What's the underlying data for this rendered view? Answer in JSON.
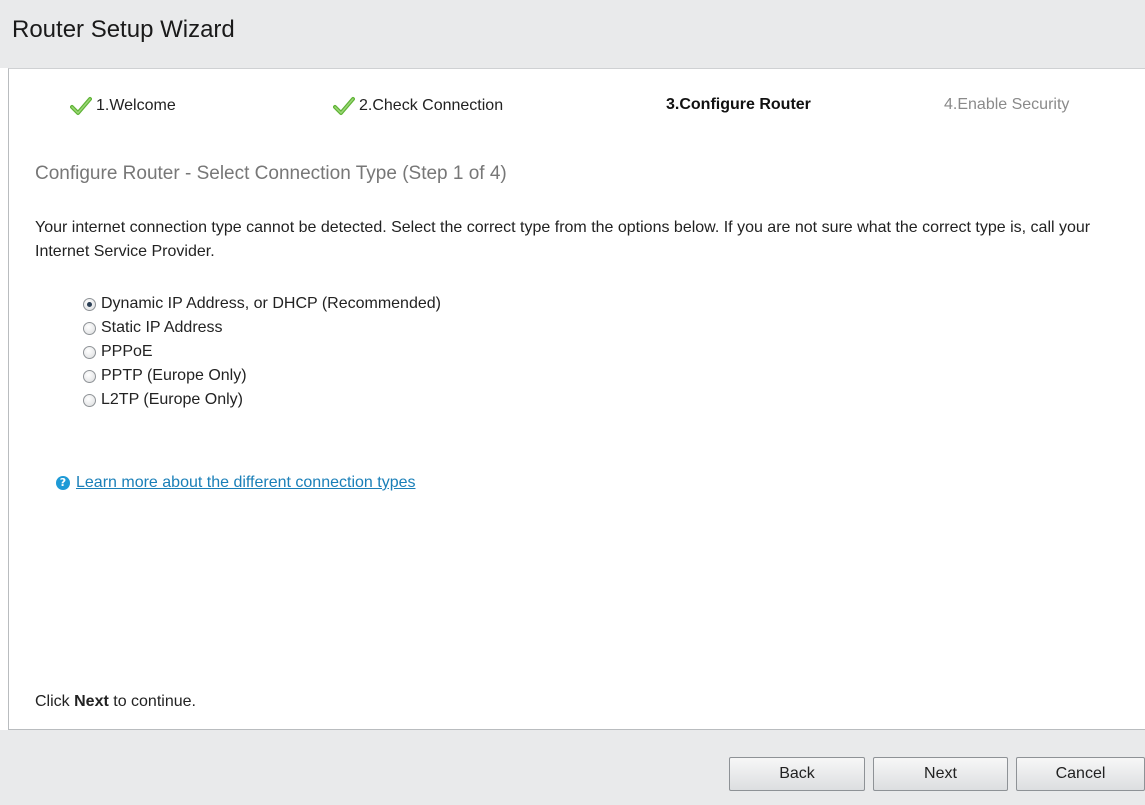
{
  "window": {
    "title": "Router Setup Wizard"
  },
  "steps": [
    {
      "label": "1.Welcome",
      "status": "completed",
      "icon": "checkmark-icon"
    },
    {
      "label": "2.Check Connection",
      "status": "completed",
      "icon": "checkmark-icon"
    },
    {
      "label": "3.Configure Router",
      "status": "current"
    },
    {
      "label": "4.Enable Security",
      "status": "upcoming"
    }
  ],
  "content": {
    "heading": "Configure Router - Select Connection Type (Step 1 of 4)",
    "intro": "Your internet connection type cannot be detected. Select the correct type from the options below. If you are not sure what the correct type is, call your Internet Service Provider.",
    "connection_types": [
      {
        "label": "Dynamic IP Address, or DHCP (Recommended)",
        "selected": true
      },
      {
        "label": "Static IP Address",
        "selected": false
      },
      {
        "label": "PPPoE",
        "selected": false
      },
      {
        "label": "PPTP (Europe Only)",
        "selected": false
      },
      {
        "label": "L2TP (Europe Only)",
        "selected": false
      }
    ],
    "learn_more_link": "Learn more about the different connection types",
    "continue_prefix": "Click ",
    "continue_emphasis": "Next",
    "continue_suffix": " to continue."
  },
  "buttons": {
    "back": "Back",
    "next": "Next",
    "cancel": "Cancel"
  },
  "colors": {
    "check_green": "#5fb336",
    "link_blue": "#1a7fb8",
    "help_icon_blue": "#1e9ad6",
    "heading_gray": "#777777",
    "future_step_gray": "#8a8a8a",
    "chrome_gray": "#e9eaeb"
  }
}
